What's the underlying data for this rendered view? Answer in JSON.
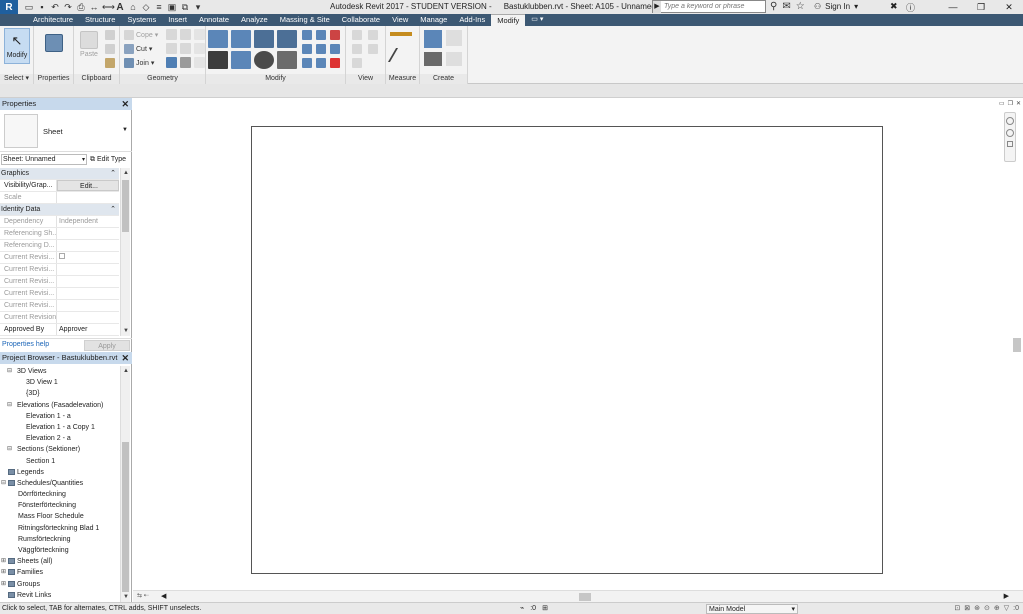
{
  "app": {
    "title": "Autodesk Revit 2017 - STUDENT VERSION -",
    "document": "Bastuklubben.rvt - Sheet: A105 - Unnamed",
    "logo": "R"
  },
  "search": {
    "placeholder": "Type a keyword or phrase"
  },
  "signin": "Sign In",
  "tabs": [
    "Architecture",
    "Structure",
    "Systems",
    "Insert",
    "Annotate",
    "Analyze",
    "Massing & Site",
    "Collaborate",
    "View",
    "Manage",
    "Add-Ins",
    "Modify"
  ],
  "active_tab": "Modify",
  "ribbon": {
    "modify_label": "Modify",
    "select_panel": "Select",
    "properties_panel": "Properties",
    "clipboard": {
      "label": "Clipboard",
      "paste": "Paste"
    },
    "geometry": {
      "label": "Geometry",
      "cope": "Cope",
      "cut": "Cut",
      "join": "Join"
    },
    "modify_panel": "Modify",
    "view_panel": "View",
    "measure_panel": "Measure",
    "create_panel": "Create"
  },
  "properties": {
    "title": "Properties",
    "type_name": "Sheet",
    "instance_filter": "Sheet: Unnamed",
    "edit_type": "Edit Type",
    "groups": [
      {
        "name": "Graphics",
        "rows": [
          {
            "key": "Visibility/Grap...",
            "value": "Edit...",
            "button": true
          },
          {
            "key": "Scale",
            "value": ""
          }
        ]
      },
      {
        "name": "Identity Data",
        "rows": [
          {
            "key": "Dependency",
            "value": "Independent",
            "muted": true
          },
          {
            "key": "Referencing Sh...",
            "value": "",
            "muted": true
          },
          {
            "key": "Referencing D...",
            "value": "",
            "muted": true
          },
          {
            "key": "Current Revisi...",
            "value": "",
            "muted": true
          },
          {
            "key": "Current Revisi...",
            "value": "",
            "muted": true
          },
          {
            "key": "Current Revisi...",
            "value": "",
            "muted": true
          },
          {
            "key": "Current Revisi...",
            "value": "",
            "muted": true
          },
          {
            "key": "Current Revisi...",
            "value": "",
            "muted": true
          },
          {
            "key": "Current Revision",
            "value": "",
            "muted": true
          },
          {
            "key": "Approved By",
            "value": "Approver"
          }
        ]
      }
    ],
    "help_link": "Properties help",
    "apply": "Apply"
  },
  "browser": {
    "title": "Project Browser - Bastuklubben.rvt",
    "nodes": [
      {
        "label": "3D Views",
        "level": 1,
        "toggle": "⊟"
      },
      {
        "label": "3D View 1",
        "level": 2
      },
      {
        "label": "{3D}",
        "level": 2
      },
      {
        "label": "Elevations (Fasadelevation)",
        "level": 1,
        "toggle": "⊟"
      },
      {
        "label": "Elevation 1 - a",
        "level": 2
      },
      {
        "label": "Elevation 1 - a Copy 1",
        "level": 2
      },
      {
        "label": "Elevation 2 - a",
        "level": 2
      },
      {
        "label": "Sections (Sektioner)",
        "level": 1,
        "toggle": "⊟"
      },
      {
        "label": "Section 1",
        "level": 2
      },
      {
        "label": "Legends",
        "level": 0,
        "icon": true
      },
      {
        "label": "Schedules/Quantities",
        "level": 0,
        "icon": true,
        "toggle": "⊟"
      },
      {
        "label": "Dörrförteckning",
        "level": 1
      },
      {
        "label": "Fönsterförteckning",
        "level": 1
      },
      {
        "label": "Mass Floor Schedule",
        "level": 1
      },
      {
        "label": "Ritningsförteckning Blad 1",
        "level": 1
      },
      {
        "label": "Rumsförteckning",
        "level": 1
      },
      {
        "label": "Väggförteckning",
        "level": 1
      },
      {
        "label": "Sheets (all)",
        "level": 0,
        "icon": true,
        "toggle": "⊞"
      },
      {
        "label": "Families",
        "level": 0,
        "icon": true,
        "toggle": "⊞"
      },
      {
        "label": "Groups",
        "level": 0,
        "icon": true,
        "toggle": "⊞"
      },
      {
        "label": "Revit Links",
        "level": 0,
        "icon": true
      }
    ]
  },
  "status": {
    "message": "Click to select, TAB for alternates, CTRL adds, SHIFT unselects.",
    "workset": ":0",
    "model": "Main Model"
  },
  "colors": {
    "tab_bar": "#3c5873",
    "panel_header": "#c7d9ec",
    "ribbon_bg": "#f3f3f3"
  }
}
